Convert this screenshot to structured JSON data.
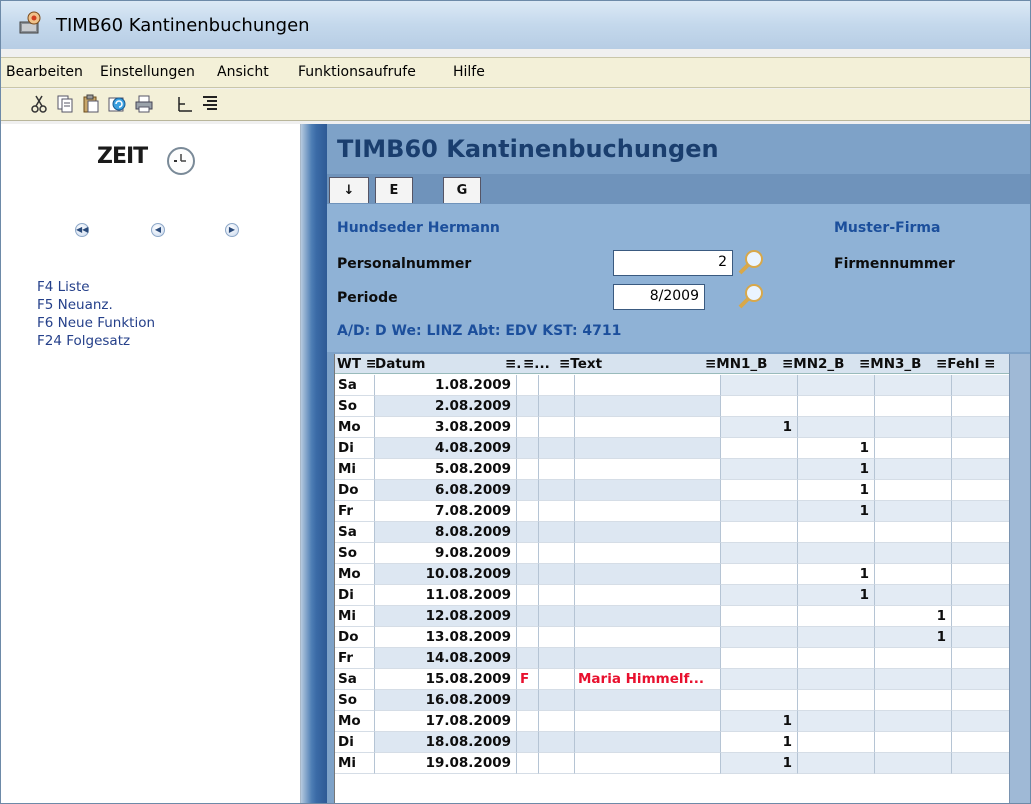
{
  "window": {
    "title": "TIMB60  Kantinenbuchungen"
  },
  "menu": {
    "items": [
      "Bearbeiten",
      "Einstellungen",
      "Ansicht",
      "Funktionsaufrufe",
      "Hilfe"
    ]
  },
  "toolbar": {
    "icons": [
      "cut-icon",
      "copy-icon",
      "paste-icon",
      "refresh-icon",
      "print-icon",
      "tree-align-icon",
      "justify-align-icon"
    ]
  },
  "sidebar": {
    "logo_text": "ZEIT",
    "function_keys": [
      "F4 Liste",
      "F5 Neuanz.",
      "F6 Neue Funktion",
      "F24 Folgesatz"
    ]
  },
  "main": {
    "title": "TIMB60  Kantinenbuchungen",
    "tabs": [
      "↓",
      "E",
      "G"
    ],
    "employee_name": "Hundseder Hermann",
    "company_name": "Muster-Firma",
    "personalnummer_label": "Personalnummer",
    "personalnummer_value": "2",
    "firmennummer_label": "Firmennummer",
    "periode_label": "Periode",
    "periode_value": "8/2009",
    "info_line": "A/D: D  We: LINZ  Abt: EDV  KST: 4711"
  },
  "grid": {
    "headers": [
      "WT ≡",
      "Datum",
      "≡.",
      "≡...",
      "≡Text",
      "≡MN1_B",
      "≡MN2_B",
      "≡MN3_B",
      "≡Fehl ≡"
    ],
    "rows": [
      [
        "Sa",
        "1.08.2009",
        "",
        "",
        "",
        "",
        "",
        "",
        ""
      ],
      [
        "So",
        "2.08.2009",
        "",
        "",
        "",
        "",
        "",
        "",
        ""
      ],
      [
        "Mo",
        "3.08.2009",
        "",
        "",
        "",
        "1",
        "",
        "",
        ""
      ],
      [
        "Di",
        "4.08.2009",
        "",
        "",
        "",
        "",
        "1",
        "",
        ""
      ],
      [
        "Mi",
        "5.08.2009",
        "",
        "",
        "",
        "",
        "1",
        "",
        ""
      ],
      [
        "Do",
        "6.08.2009",
        "",
        "",
        "",
        "",
        "1",
        "",
        ""
      ],
      [
        "Fr",
        "7.08.2009",
        "",
        "",
        "",
        "",
        "1",
        "",
        ""
      ],
      [
        "Sa",
        "8.08.2009",
        "",
        "",
        "",
        "",
        "",
        "",
        ""
      ],
      [
        "So",
        "9.08.2009",
        "",
        "",
        "",
        "",
        "",
        "",
        ""
      ],
      [
        "Mo",
        "10.08.2009",
        "",
        "",
        "",
        "",
        "1",
        "",
        ""
      ],
      [
        "Di",
        "11.08.2009",
        "",
        "",
        "",
        "",
        "1",
        "",
        ""
      ],
      [
        "Mi",
        "12.08.2009",
        "",
        "",
        "",
        "",
        "",
        "1",
        ""
      ],
      [
        "Do",
        "13.08.2009",
        "",
        "",
        "",
        "",
        "",
        "1",
        ""
      ],
      [
        "Fr",
        "14.08.2009",
        "",
        "",
        "",
        "",
        "",
        "",
        ""
      ],
      [
        "Sa",
        "15.08.2009",
        "F",
        "",
        "Maria Himmelf...",
        "",
        "",
        "",
        ""
      ],
      [
        "So",
        "16.08.2009",
        "",
        "",
        "",
        "",
        "",
        "",
        ""
      ],
      [
        "Mo",
        "17.08.2009",
        "",
        "",
        "",
        "1",
        "",
        "",
        ""
      ],
      [
        "Di",
        "18.08.2009",
        "",
        "",
        "",
        "1",
        "",
        "",
        ""
      ],
      [
        "Mi",
        "19.08.2009",
        "",
        "",
        "",
        "1",
        "",
        "",
        ""
      ]
    ],
    "highlight_color": "#e8102e"
  }
}
